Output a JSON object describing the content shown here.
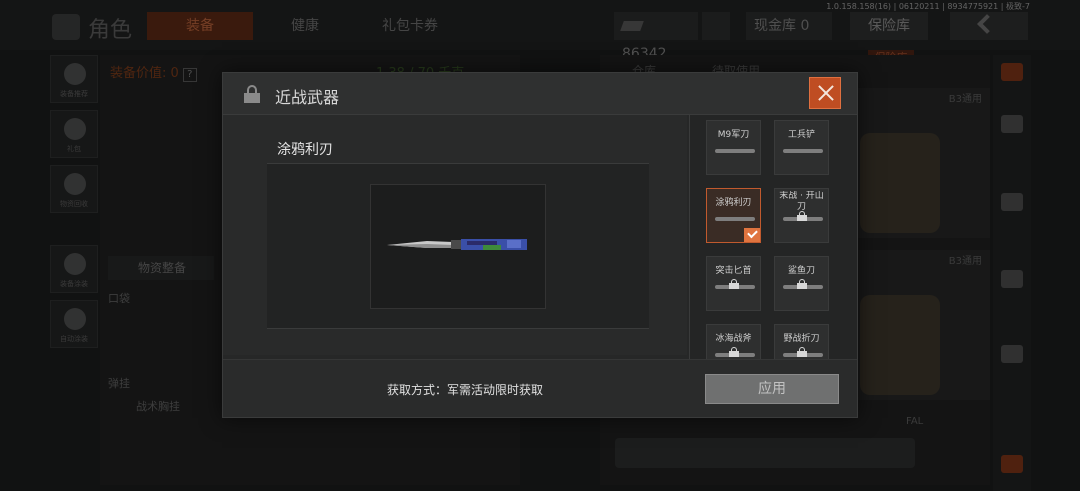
{
  "version": "1.0.158.158(16) | 06120211 | 8934775921 | 极致-7",
  "background": {
    "char_title": "角色",
    "tabs": [
      "装备",
      "健康",
      "礼包卡券"
    ],
    "currency": "86342",
    "cash_vault": "现金库 0",
    "vault_button": "保险库",
    "vault_tag": "保险库",
    "equip_value": "装备价值: 0",
    "equip_help": "?",
    "weight": "1.38 / 70 千克",
    "side_buttons": [
      "装备推荐",
      "礼包",
      "物资回收",
      "装备涂装",
      "自动涂装"
    ],
    "organize": "物资整备",
    "pocket": "口袋",
    "hanging": "弹挂",
    "tactical_vest": "战术胸挂",
    "rp_tabs": [
      "仓库",
      "待取使用"
    ],
    "rp_tag_1": "B3通用",
    "rp_tag_2": "B3通用",
    "fal": "FAL"
  },
  "modal": {
    "title": "近战武器",
    "selected_weapon": "涂鸦利刃",
    "acquire_text": "获取方式：军需活动限时获取",
    "apply_label": "应用",
    "items": [
      {
        "name": "M9军刀",
        "locked": false,
        "selected": false
      },
      {
        "name": "工兵铲",
        "locked": false,
        "selected": false
      },
      {
        "name": "涂鸦利刃",
        "locked": false,
        "selected": true
      },
      {
        "name": "末战 · 开山刀",
        "locked": true,
        "selected": false
      },
      {
        "name": "突击匕首",
        "locked": true,
        "selected": false
      },
      {
        "name": "鲨鱼刀",
        "locked": true,
        "selected": false
      },
      {
        "name": "冰海战斧",
        "locked": true,
        "selected": false
      },
      {
        "name": "野战折刀",
        "locked": true,
        "selected": false
      }
    ]
  },
  "colors": {
    "accent": "#e0743f",
    "close_bg": "#bf4d22",
    "knife_blade": "#c9c9c9",
    "knife_handle": "#3a4fa8",
    "knife_green": "#3e8a3a"
  }
}
